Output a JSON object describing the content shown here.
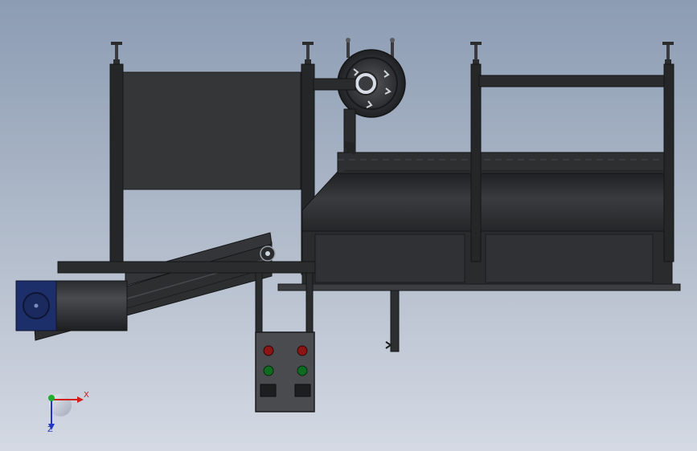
{
  "triad": {
    "x_label": "X",
    "z_label": "Z",
    "x_color": "#d41f1f",
    "y_color": "#1fae2b",
    "z_color": "#2236c9"
  },
  "model": {
    "body_color": "#2c2d2f",
    "frame_color": "#222326",
    "motor_color": "#1c2f6b",
    "panel_color": "#4a4b4e",
    "stop_lamp_color": "#8d1414",
    "go_lamp_color": "#0f6a22"
  },
  "control_panel": {
    "lamps": [
      "stop",
      "stop",
      "go",
      "go"
    ],
    "switch_count": 2
  }
}
